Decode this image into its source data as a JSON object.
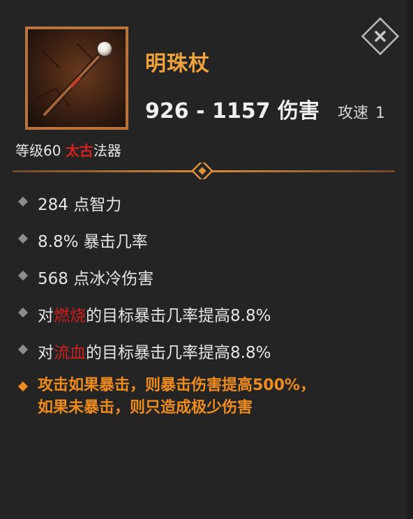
{
  "item": {
    "name": "明珠杖",
    "damage": "926 - 1157 伤害",
    "attack_speed_label": "攻速",
    "attack_speed_value": "1",
    "level_prefix": "等级60",
    "tier": "太古",
    "type": "法器",
    "icon": "staff-with-pearl-icon"
  },
  "stats": {
    "s1": "284 点智力",
    "s2": "8.8% 暴击几率",
    "s3": "568 点冰冷伤害",
    "s4_prefix": "对",
    "s4_keyword": "燃烧",
    "s4_suffix": "的目标暴击几率提高8.8%",
    "s5_prefix": "对",
    "s5_keyword": "流血",
    "s5_suffix": "的目标暴击几率提高8.8%"
  },
  "special": {
    "line1": "攻击如果暴击，则暴击伤害提高500%，",
    "line2": "如果未暴击，则只造成极少伤害"
  },
  "colors": {
    "legendary_orange": "#f08c1e",
    "name_orange": "#f0a23c",
    "ancient_red": "#d62020"
  }
}
